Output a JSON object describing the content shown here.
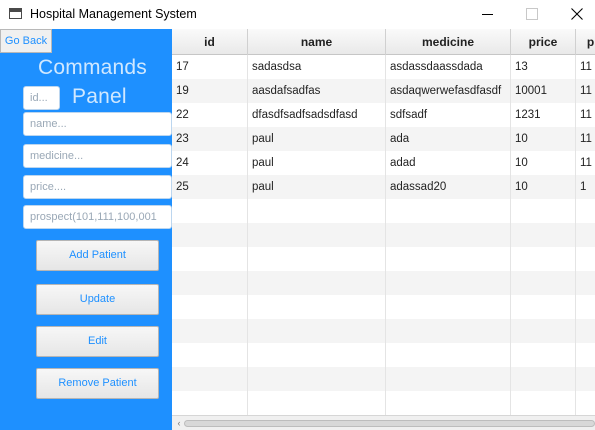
{
  "window": {
    "title": "Hospital Management System"
  },
  "left_panel": {
    "back_label": "Go Back",
    "heading_line1": "Commands",
    "heading_line2": "Panel",
    "fields": {
      "id_placeholder": "id...",
      "name_placeholder": "name...",
      "medicine_placeholder": "medicine...",
      "price_placeholder": "price....",
      "prospect_placeholder": "prospect(101,111,100,001"
    },
    "buttons": {
      "add": "Add Patient",
      "update": "Update",
      "edit": "Edit",
      "remove": "Remove Patient"
    }
  },
  "table": {
    "columns": [
      "id",
      "name",
      "medicine",
      "price",
      "p"
    ],
    "rows": [
      [
        "17",
        "sadasdsa",
        "asdassdaassdada",
        "13",
        "11"
      ],
      [
        "19",
        "aasdafsadfas",
        "asdaqwerwefasdfasdf",
        "10001",
        "11"
      ],
      [
        "22",
        "dfasdfsadfsadsdfasd",
        "sdfsadf",
        "1231",
        "11"
      ],
      [
        "23",
        "paul",
        "ada",
        "10",
        "11"
      ],
      [
        "24",
        "paul",
        "adad",
        "10",
        "11"
      ],
      [
        "25",
        "paul",
        "adassad20",
        "10",
        "1"
      ]
    ]
  },
  "colors": {
    "panel_blue": "#1e90ff",
    "heading_text": "#d0e8ff"
  }
}
